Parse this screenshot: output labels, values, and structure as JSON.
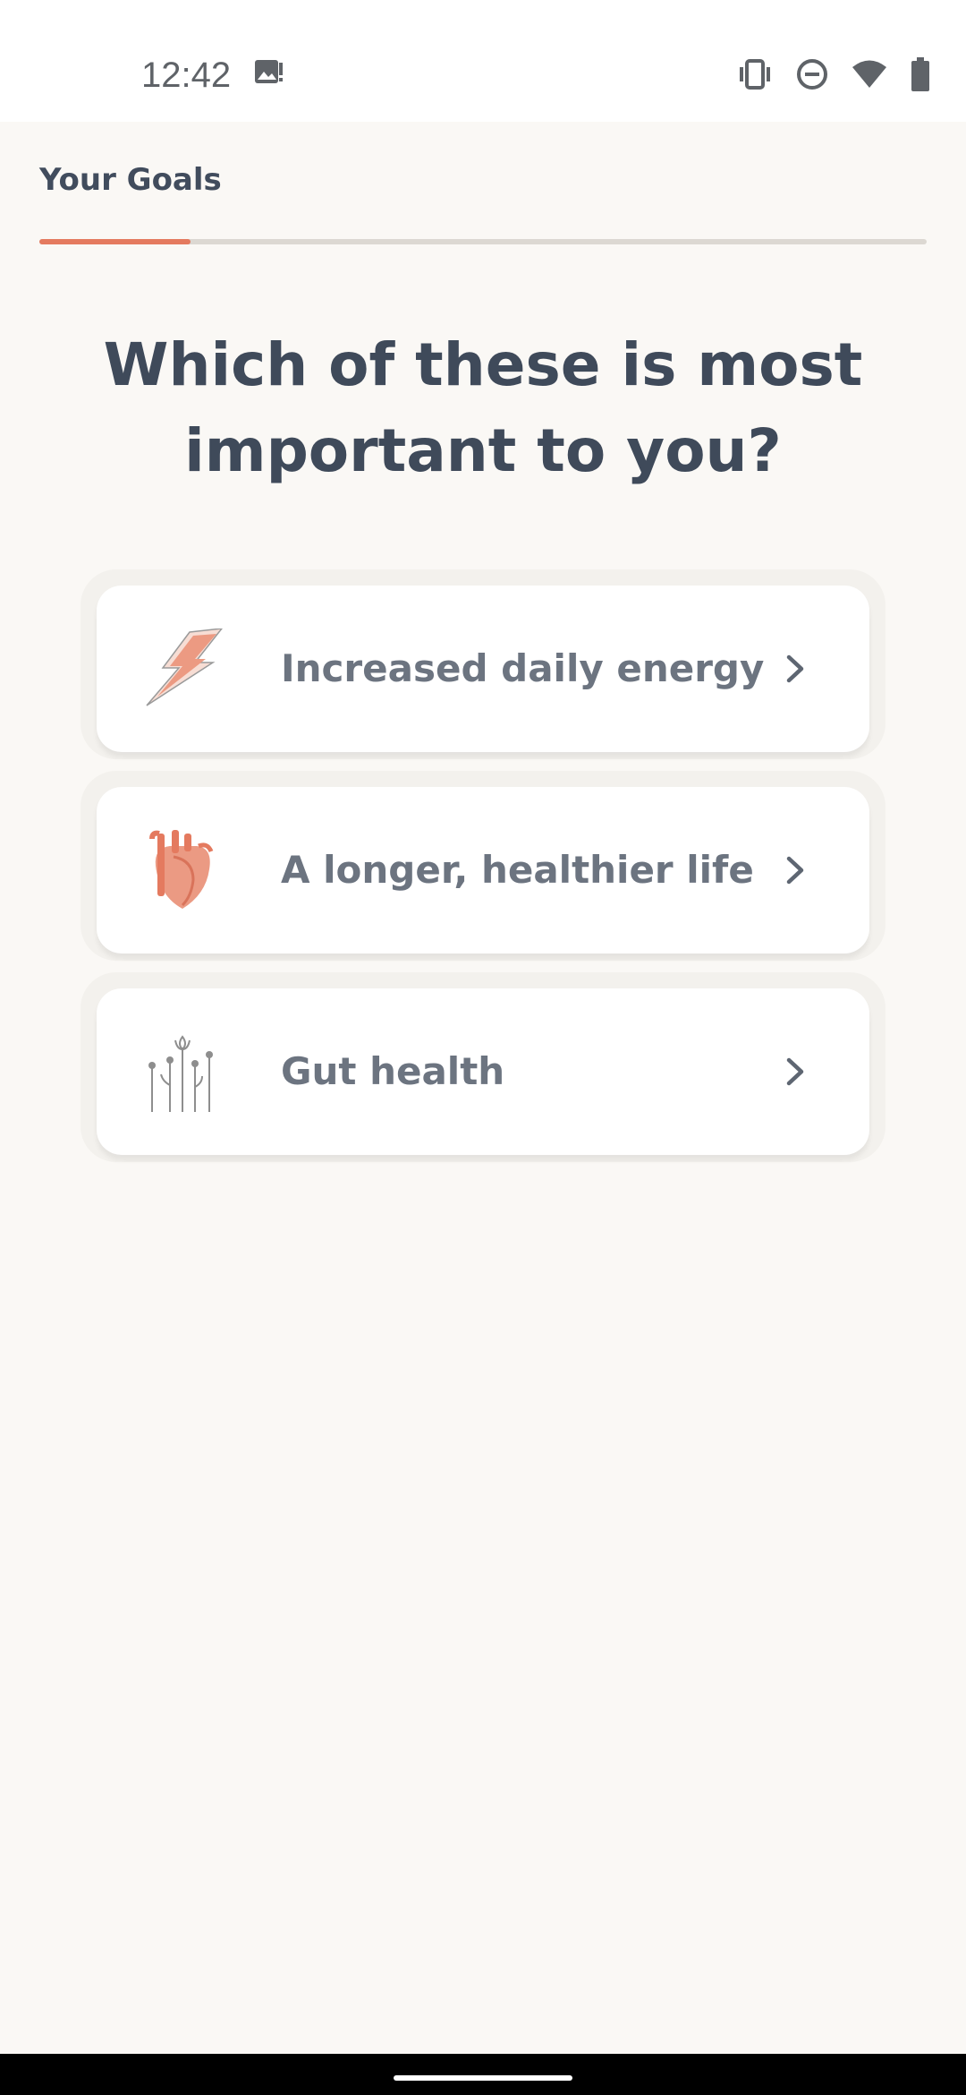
{
  "status_bar": {
    "time": "12:42",
    "left_icons": [
      "image-alert-icon"
    ],
    "right_icons": [
      "vibrate-icon",
      "do-not-disturb-icon",
      "wifi-icon",
      "battery-icon"
    ]
  },
  "header": {
    "title": "Your Goals",
    "progress_fraction": 0.17,
    "accent_color": "#e47a5f",
    "track_color": "#dcd8d2"
  },
  "question": {
    "text": "Which of these is most important to you?"
  },
  "options": [
    {
      "label": "Increased daily energy",
      "icon": "lightning-bolt-icon"
    },
    {
      "label": "A longer, healthier life",
      "icon": "heart-anatomy-icon"
    },
    {
      "label": "Gut health",
      "icon": "flowers-icon"
    }
  ],
  "colors": {
    "background": "#faf8f5",
    "card": "#ffffff",
    "text_dark": "#3f4a5a",
    "text_muted": "#6c7480"
  }
}
